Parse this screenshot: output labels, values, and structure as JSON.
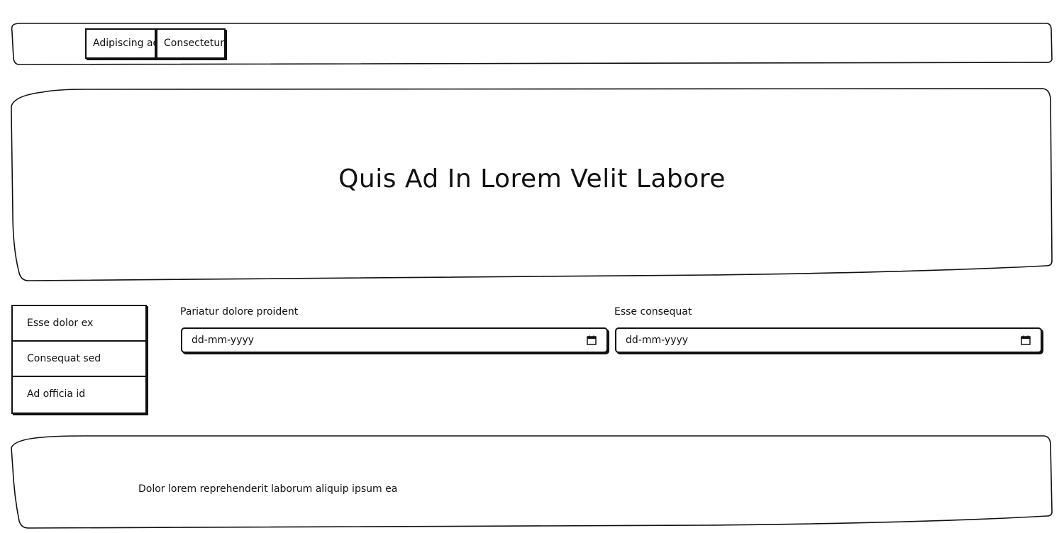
{
  "nav": {
    "items": [
      {
        "label": "Adipiscing ad"
      },
      {
        "label": "Consectetur"
      }
    ]
  },
  "hero": {
    "title": "Quis Ad In Lorem Velit Labore"
  },
  "sidebar": {
    "items": [
      {
        "label": "Esse dolor ex"
      },
      {
        "label": "Consequat sed"
      },
      {
        "label": "Ad officia id"
      }
    ]
  },
  "form": {
    "fields": [
      {
        "label": "Pariatur dolore proident",
        "placeholder": "dd-mm-yyyy",
        "icon": "calendar-icon"
      },
      {
        "label": "Esse consequat",
        "placeholder": "dd-mm-yyyy",
        "icon": "calendar-icon"
      }
    ]
  },
  "footer": {
    "text": "Dolor lorem reprehenderit laborum aliquip ipsum ea"
  }
}
